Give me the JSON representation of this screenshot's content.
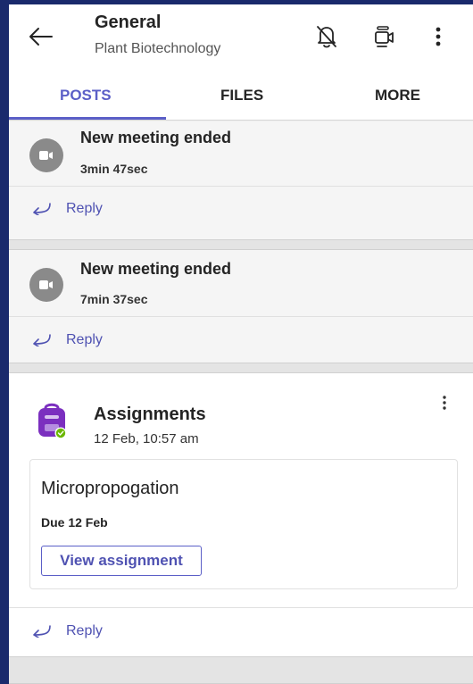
{
  "header": {
    "title": "General",
    "subtitle": "Plant Biotechnology",
    "icons": [
      "back-arrow-icon",
      "bell-off-icon",
      "video-call-icon",
      "more-vertical-icon"
    ]
  },
  "tabs": [
    {
      "label": "POSTS",
      "active": true
    },
    {
      "label": "FILES",
      "active": false
    },
    {
      "label": "MORE",
      "active": false
    }
  ],
  "posts": [
    {
      "title": "New meeting ended",
      "duration": "3min 47sec",
      "reply": "Reply"
    },
    {
      "title": "New meeting ended",
      "duration": "7min 37sec",
      "reply": "Reply"
    }
  ],
  "assignment": {
    "app_name": "Assignments",
    "time": "12 Feb, 10:57 am",
    "task_title": "Micropropogation",
    "due": "Due 12 Feb",
    "button": "View assignment",
    "reply": "Reply"
  },
  "colors": {
    "accent": "#5b5fc7",
    "link": "#4f52b2",
    "assignment_icon": "#7b2fbf",
    "status_green": "#6bb700"
  }
}
